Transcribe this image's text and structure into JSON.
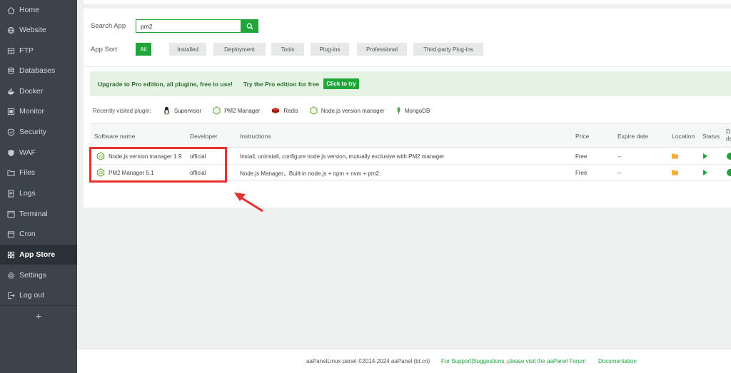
{
  "sidebar": {
    "items": [
      {
        "label": "Home",
        "icon": "home-icon"
      },
      {
        "label": "Website",
        "icon": "globe-icon"
      },
      {
        "label": "FTP",
        "icon": "ftp-icon"
      },
      {
        "label": "Databases",
        "icon": "database-icon"
      },
      {
        "label": "Docker",
        "icon": "docker-icon"
      },
      {
        "label": "Monitor",
        "icon": "monitor-icon"
      },
      {
        "label": "Security",
        "icon": "shield-icon"
      },
      {
        "label": "WAF",
        "icon": "waf-shield-icon"
      },
      {
        "label": "Files",
        "icon": "folder-icon"
      },
      {
        "label": "Logs",
        "icon": "logs-icon"
      },
      {
        "label": "Terminal",
        "icon": "terminal-icon"
      },
      {
        "label": "Cron",
        "icon": "calendar-icon"
      },
      {
        "label": "App Store",
        "icon": "grid-icon",
        "active": true
      },
      {
        "label": "Settings",
        "icon": "gear-icon"
      },
      {
        "label": "Log out",
        "icon": "logout-icon"
      }
    ],
    "add_label": "+"
  },
  "search": {
    "label": "Search App",
    "value": "pm2"
  },
  "sort": {
    "label": "App Sort",
    "options": [
      "All",
      "Installed",
      "Deployment",
      "Tools",
      "Plug-ins",
      "Professional",
      "Third-party Plug-ins"
    ],
    "selected": "All"
  },
  "promo": {
    "text": "Upgrade to Pro edition, all plugins, free to use!",
    "try_text": "Try the Pro edition for free",
    "button": "Click to try"
  },
  "recent": {
    "label": "Recently visited plugin:",
    "items": [
      "Supervisor",
      "PM2 Manager",
      "Redis",
      "Node.js version manager",
      "MongoDB"
    ]
  },
  "table": {
    "headers": [
      "Software name",
      "Developer",
      "Instructions",
      "Price",
      "Expire date",
      "Location",
      "Status",
      "D da"
    ],
    "rows": [
      {
        "name": "Node.js version manager 1.9",
        "developer": "official",
        "instructions": "Install, uninstall, configure node.js version, mutually exclusive with PM2 manager",
        "price": "Free",
        "expire": "--"
      },
      {
        "name": "PM2 Manager 5.1",
        "developer": "official",
        "instructions": "Node.js Manager，Built-in node.js + npm + nvm + pm2.",
        "price": "Free",
        "expire": "--"
      }
    ]
  },
  "footer": {
    "copyright": "aaPanelLinux panel ©2014-2024 aaPanel (bt.cn)",
    "support": "For Support|Suggestions, please visit the aaPanel Forum",
    "docs": "Documentation"
  },
  "colors": {
    "accent": "#20a53a",
    "sidebar": "#3b434b",
    "highlight": "#e8312f"
  }
}
